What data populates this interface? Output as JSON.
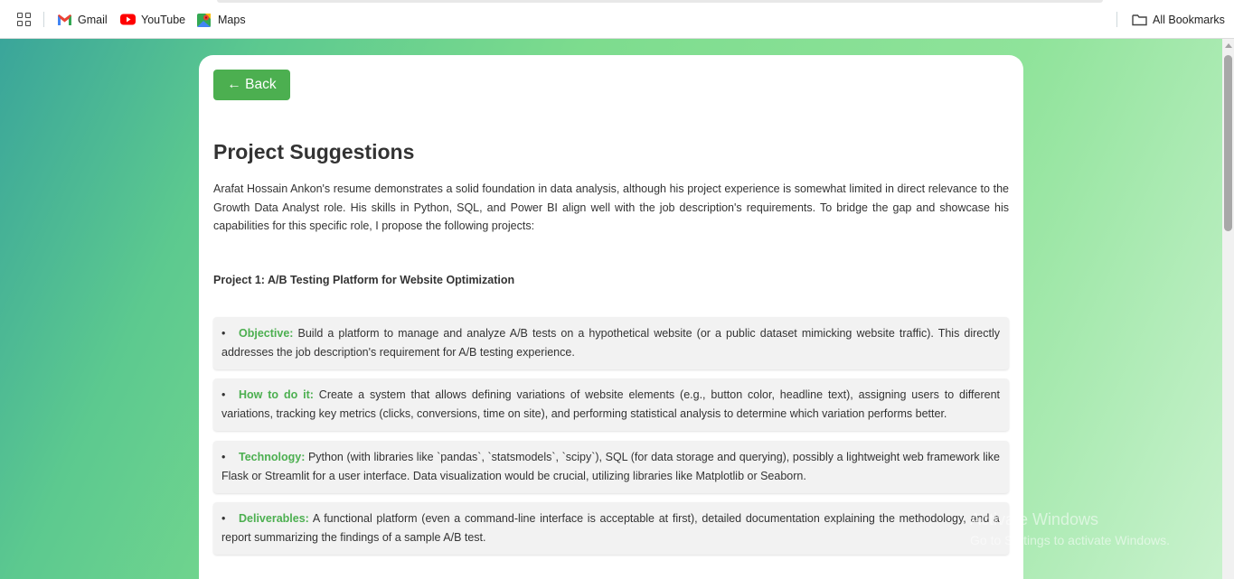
{
  "bookmarks_bar": {
    "items": [
      {
        "label": "Gmail",
        "icon": "gmail-icon"
      },
      {
        "label": "YouTube",
        "icon": "youtube-icon"
      },
      {
        "label": "Maps",
        "icon": "maps-icon"
      }
    ],
    "all_bookmarks": "All Bookmarks"
  },
  "page": {
    "back_label": "← Back",
    "title": "Project Suggestions",
    "intro": "Arafat Hossain Ankon's resume demonstrates a solid foundation in data analysis, although his project experience is somewhat limited in direct relevance to the Growth Data Analyst role. His skills in Python, SQL, and Power BI align well with the job description's requirements. To bridge the gap and showcase his capabilities for this specific role, I propose the following projects:",
    "project_heading": "Project 1: A/B Testing Platform for Website Optimization",
    "items": [
      {
        "bullet": "•",
        "label": "Objective:",
        "text": " Build a platform to manage and analyze A/B tests on a hypothetical website (or a public dataset mimicking website traffic). This directly addresses the job description's requirement for A/B testing experience."
      },
      {
        "bullet": "•",
        "label": "How to do it:",
        "text": " Create a system that allows defining variations of website elements (e.g., button color, headline text), assigning users to different variations, tracking key metrics (clicks, conversions, time on site), and performing statistical analysis to determine which variation performs better."
      },
      {
        "bullet": "•",
        "label": "Technology:",
        "text": " Python (with libraries like `pandas`, `statsmodels`, `scipy`), SQL (for data storage and querying), possibly a lightweight web framework like Flask or Streamlit for a user interface. Data visualization would be crucial, utilizing libraries like Matplotlib or Seaborn."
      },
      {
        "bullet": "•",
        "label": "Deliverables:",
        "text": " A functional platform (even a command-line interface is acceptable at first), detailed documentation explaining the methodology, and a report summarizing the findings of a sample A/B test."
      }
    ]
  },
  "watermark": {
    "line1": "Activate Windows",
    "line2": "Go to Settings to activate Windows."
  },
  "colors": {
    "accent": "#4caf50",
    "card_bg": "#ffffff",
    "item_bg": "#f2f2f2"
  }
}
